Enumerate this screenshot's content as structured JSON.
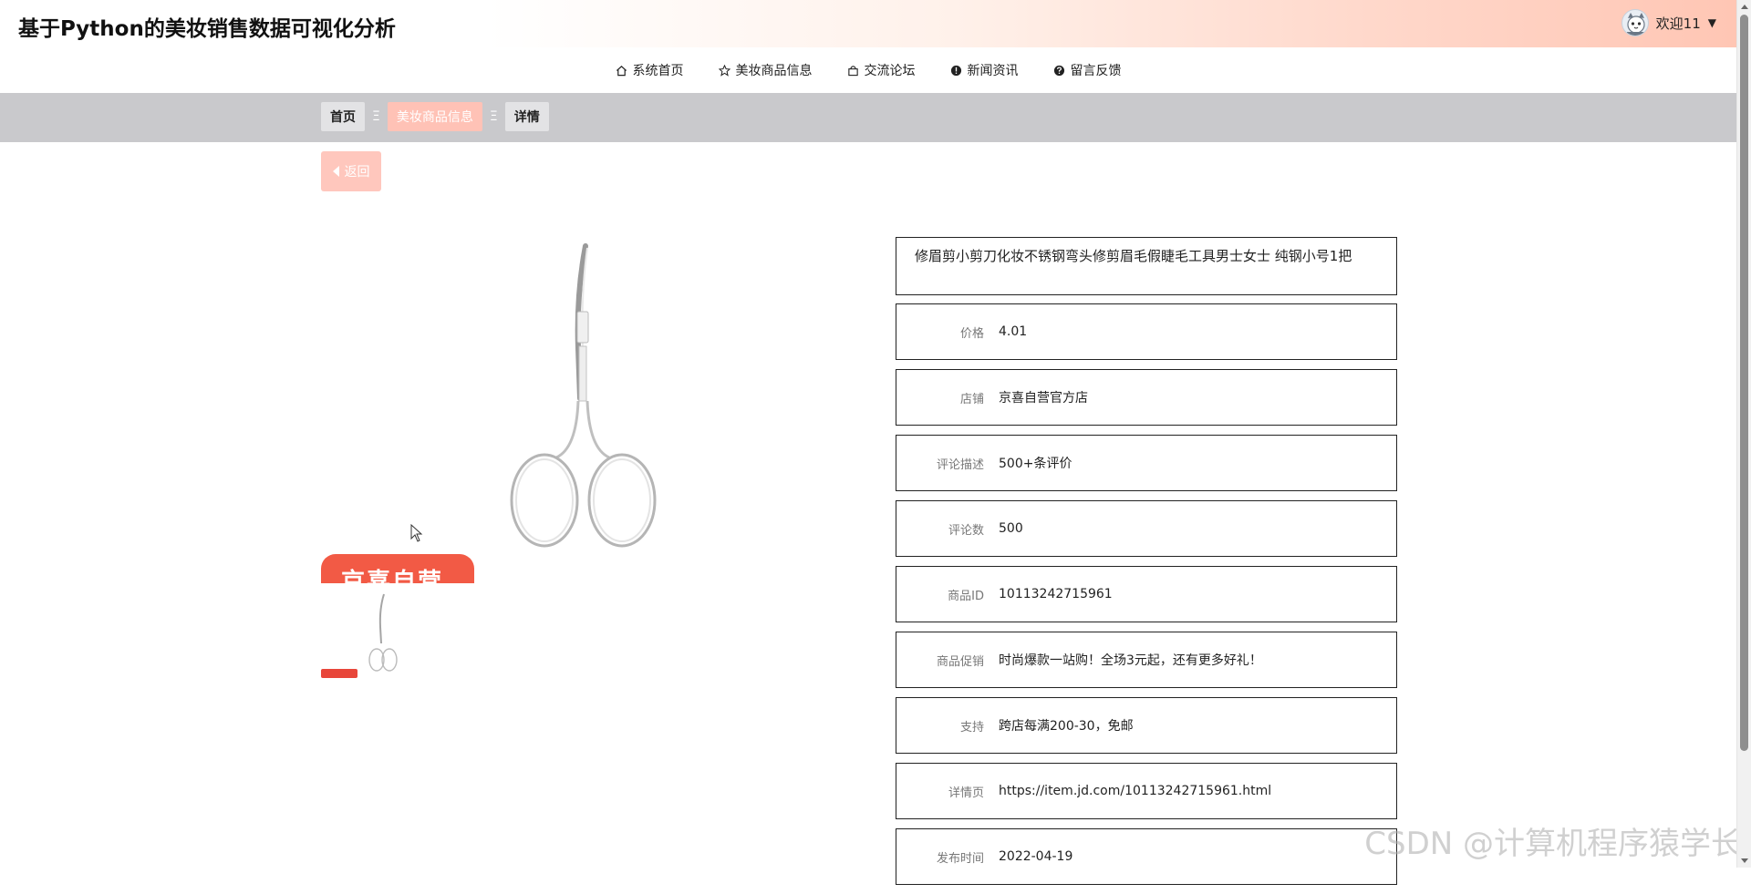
{
  "header": {
    "site_title": "基于Python的美妆销售数据可视化分析",
    "user_label": "欢迎11",
    "user_caret": "▼",
    "avatar_icon": "cat-avatar-icon"
  },
  "nav": {
    "items": [
      {
        "label": "系统首页",
        "icon": "home-icon"
      },
      {
        "label": "美妆商品信息",
        "icon": "star-icon"
      },
      {
        "label": "交流论坛",
        "icon": "bag-icon"
      },
      {
        "label": "新闻资讯",
        "icon": "info-circle-icon"
      },
      {
        "label": "留言反馈",
        "icon": "question-circle-icon"
      }
    ]
  },
  "breadcrumb": {
    "items": [
      "首页",
      "美妆商品信息",
      "详情"
    ],
    "separator": "Ξ"
  },
  "back_button": {
    "label": "返回",
    "icon": "caret-left-icon"
  },
  "product": {
    "title": "修眉剪小剪刀化妆不锈钢弯头修剪眉毛假睫毛工具男士女士 纯钢小号1把",
    "promo_text": "京喜自营",
    "details": [
      {
        "label": "价格",
        "value": "4.01"
      },
      {
        "label": "店铺",
        "value": "京喜自营官方店"
      },
      {
        "label": "评论描述",
        "value": "500+条评价"
      },
      {
        "label": "评论数",
        "value": "500"
      },
      {
        "label": "商品ID",
        "value": "10113242715961"
      },
      {
        "label": "商品促销",
        "value": "时尚爆款一站购！全场3元起，还有更多好礼！"
      },
      {
        "label": "支持",
        "value": "跨店每满200-30，免邮"
      },
      {
        "label": "详情页",
        "value": "https://item.jd.com/10113242715961.html"
      },
      {
        "label": "发布时间",
        "value": "2022-04-19"
      }
    ]
  },
  "watermark": "CSDN @计算机程序猿学长",
  "colors": {
    "accent": "#ffc2b6",
    "back_button": "#ffc7bd",
    "promo": "#f25a45",
    "crumb_band": "#c9c9cc"
  }
}
